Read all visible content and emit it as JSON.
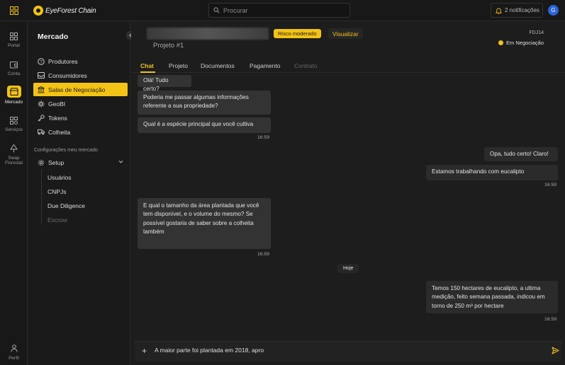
{
  "app": {
    "brand": "EyeForest Chain",
    "search_placeholder": "Procurar",
    "notifications_label": "2 notificações",
    "avatar_initial": "G",
    "accent_color": "#f3c316"
  },
  "rail": {
    "items": [
      {
        "label": "Portal",
        "icon": "portal-grid-icon"
      },
      {
        "label": "Conta",
        "icon": "wallet-icon"
      },
      {
        "label": "Mercado",
        "icon": "market-icon",
        "active": true
      },
      {
        "label": "Serviços",
        "icon": "services-icon"
      },
      {
        "label": "Swap Florestal",
        "icon": "tree-icon"
      }
    ],
    "profile_label": "Perfil"
  },
  "sidebar": {
    "title": "Mercado",
    "items": [
      {
        "label": "Produtores",
        "icon": "question-circle-icon"
      },
      {
        "label": "Consumidores",
        "icon": "inbox-icon"
      },
      {
        "label": "Salas de Negociação",
        "icon": "bank-icon",
        "active": true
      },
      {
        "label": "GeoBI",
        "icon": "geo-icon"
      },
      {
        "label": "Tokens",
        "icon": "key-icon"
      },
      {
        "label": "Colheita",
        "icon": "truck-icon"
      }
    ],
    "section_label": "Configurações meu mercado",
    "setup_label": "Setup",
    "setup_items": [
      {
        "label": "Usuários",
        "disabled": false
      },
      {
        "label": "CNPJs",
        "disabled": false
      },
      {
        "label": "Due Diligence",
        "disabled": false
      },
      {
        "label": "Escrow",
        "disabled": true
      }
    ]
  },
  "header": {
    "risk_badge": "Risco moderado",
    "visualize_label": "Visualizar",
    "project_label": "Projeto #1",
    "code": "FDJ14",
    "status": "Em Negociação"
  },
  "tabs": [
    {
      "label": "Chat",
      "state": "active"
    },
    {
      "label": "Projeto",
      "state": "normal"
    },
    {
      "label": "Documentos",
      "state": "normal"
    },
    {
      "label": "Pagamento",
      "state": "normal"
    },
    {
      "label": "Contrato",
      "state": "disabled"
    }
  ],
  "chat": {
    "messages": [
      {
        "dir": "in",
        "text": "Olá! Tudo certo?"
      },
      {
        "dir": "in",
        "text": "Poderia me passar algumas informações referente a sua propriedade?"
      },
      {
        "dir": "in",
        "text": "Qual é a espécie principal que você cultiva"
      },
      {
        "time": "16:59"
      },
      {
        "dir": "out",
        "text": "Opa, tudo certo! Claro!"
      },
      {
        "dir": "out",
        "text": "Estamos trabalhando com eucalipto"
      },
      {
        "time": "16:59"
      },
      {
        "dir": "in",
        "text": "E qual o tamanho da área plantada que você tem disponível, e o volume do mesmo? Se possível gostaria de saber sobre a colheita também"
      },
      {
        "time": "16:59"
      },
      {
        "dir": "out",
        "text": "Temos 150 hectares de eucalipto, a ultima medição, feito semana passada, indicou em torno de 250 m³ por hectare"
      },
      {
        "time": "16:59"
      }
    ],
    "day_separator": "Hoje",
    "composer_value": "A maior parte foi plantada em 2018, apro"
  }
}
